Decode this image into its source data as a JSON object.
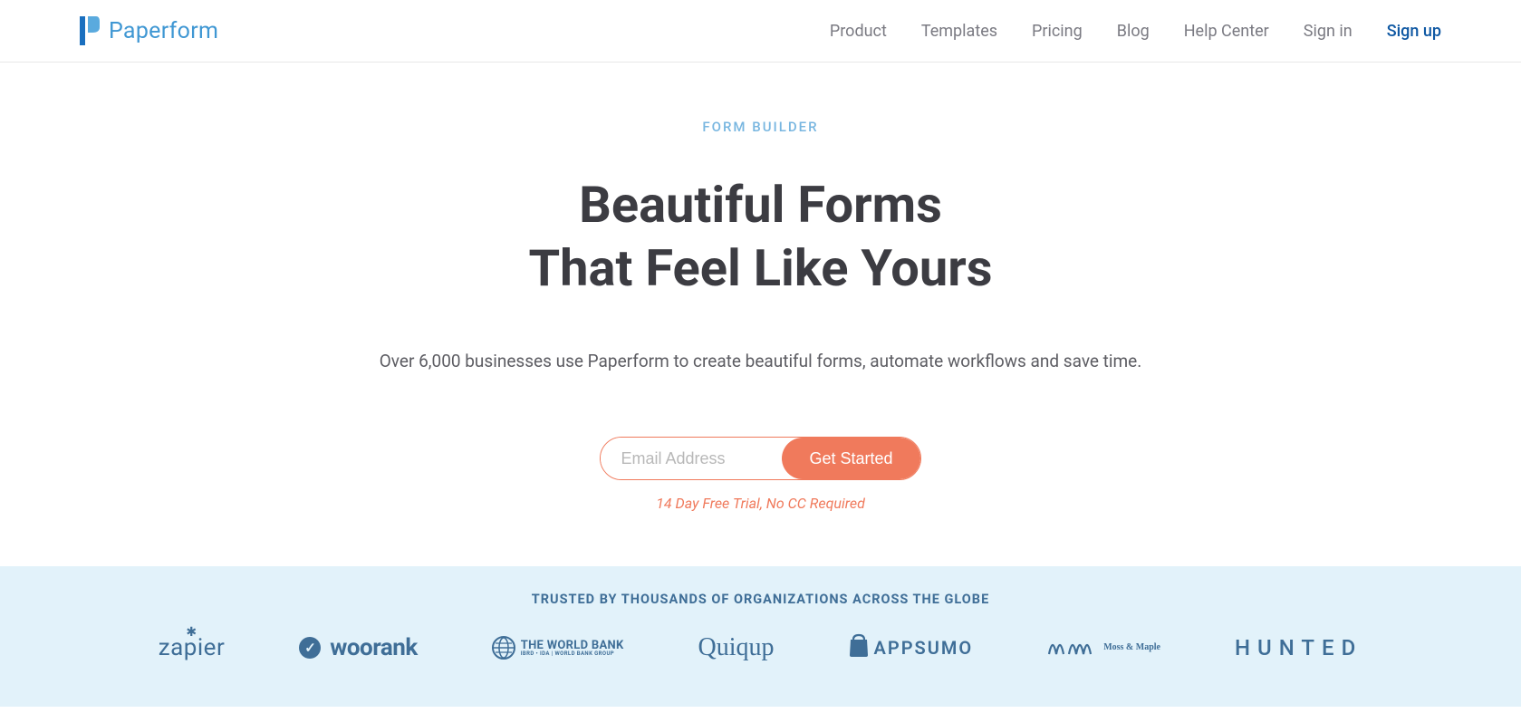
{
  "brand": {
    "name": "Paperform",
    "accent": "#3f97d3",
    "cta_bg": "#f07a5c"
  },
  "nav": {
    "items": [
      {
        "label": "Product"
      },
      {
        "label": "Templates"
      },
      {
        "label": "Pricing"
      },
      {
        "label": "Blog"
      },
      {
        "label": "Help Center"
      },
      {
        "label": "Sign in"
      }
    ],
    "signup_label": "Sign up"
  },
  "hero": {
    "eyebrow": "FORM BUILDER",
    "headline_line1": "Beautiful Forms",
    "headline_line2": "That Feel Like Yours",
    "subhead": "Over 6,000 businesses use Paperform to create beautiful forms, automate workflows and save time.",
    "email_placeholder": "Email Address",
    "cta_label": "Get Started",
    "trial_note": "14 Day Free Trial, No CC Required"
  },
  "trusted": {
    "title": "TRUSTED BY THOUSANDS OF ORGANIZATIONS ACROSS THE GLOBE",
    "partners": {
      "zapier": "zapier",
      "woorank": "woorank",
      "worldbank_main": "THE WORLD BANK",
      "worldbank_sub": "IBRD • IDA | WORLD BANK GROUP",
      "quiqup": "Quiqup",
      "appsumo": "APPSUMO",
      "mossmaple": "Moss & Maple",
      "hunted": "HUNTED"
    }
  }
}
